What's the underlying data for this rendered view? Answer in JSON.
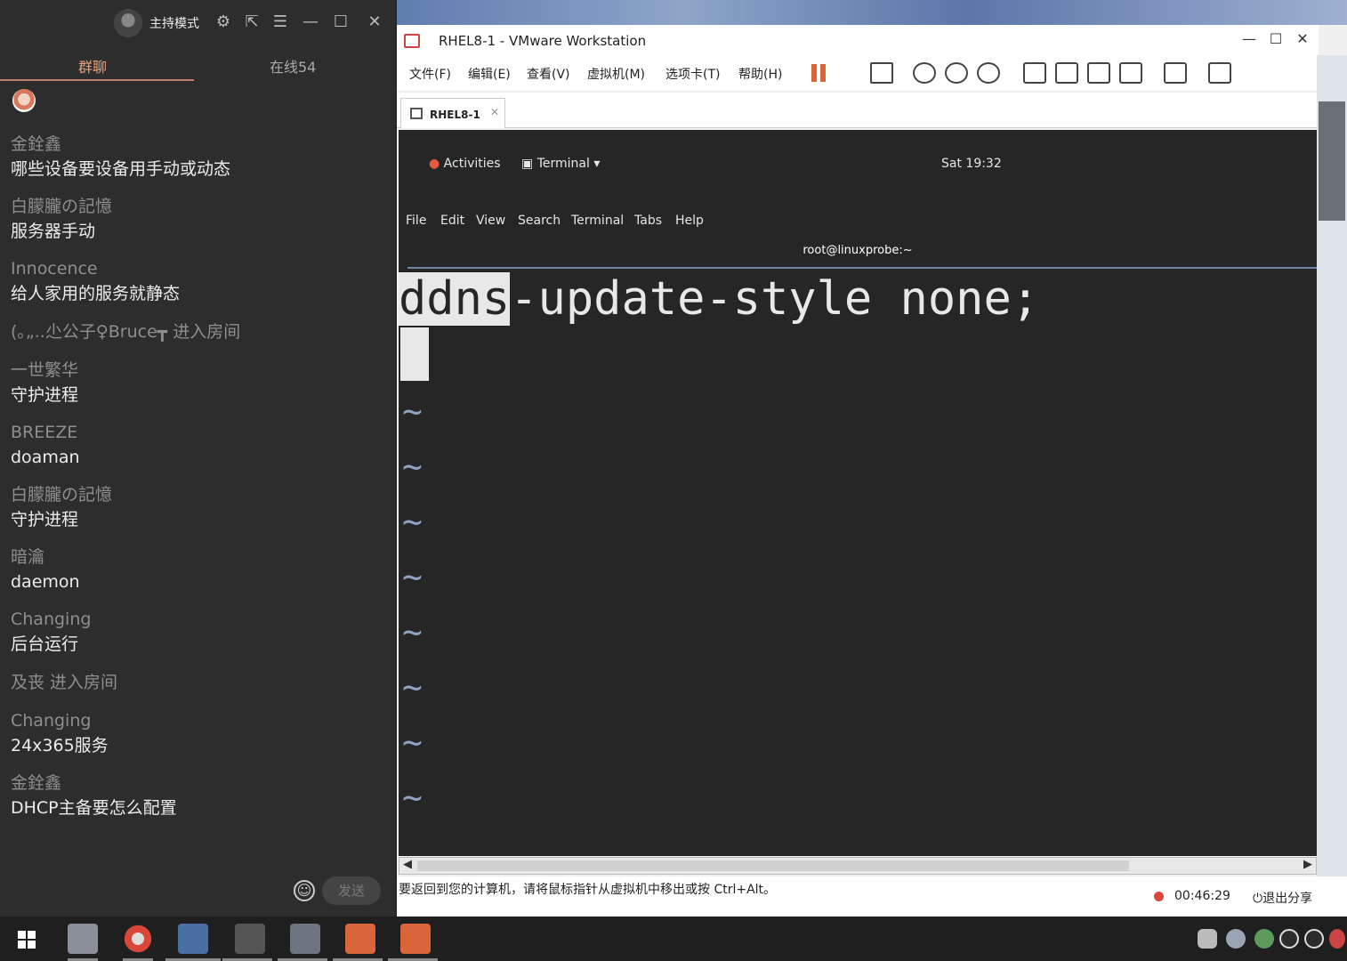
{
  "chat": {
    "host_mode": "主持模式",
    "tabs": {
      "group": "群聊",
      "online": "在线54"
    },
    "messages": [
      {
        "name": "金銓鑫",
        "text": "哪些设备要设备用手动或动态"
      },
      {
        "name": "白朦朧の記憶",
        "text": "服务器手动"
      },
      {
        "name": "Innocence",
        "text": "给人家用的服务就静态"
      },
      {
        "name": "(｡„..尐公子♀Bruce┳  进入房间",
        "text": ""
      },
      {
        "name": "一世繁华",
        "text": "守护进程"
      },
      {
        "name": "BREEZE",
        "text": "doaman"
      },
      {
        "name": "白朦朧の記憶",
        "text": "守护进程"
      },
      {
        "name": "暗瀹",
        "text": "daemon"
      },
      {
        "name": "Changing",
        "text": "后台运行"
      },
      {
        "name": "及丧 进入房间",
        "text": ""
      },
      {
        "name": "Changing",
        "text": "24x365服务"
      },
      {
        "name": "金銓鑫",
        "text": "DHCP主备要怎么配置"
      }
    ],
    "send_label": "发送"
  },
  "vmware": {
    "title": "RHEL8-1 - VMware Workstation",
    "menus": [
      "文件(F)",
      "编辑(E)",
      "查看(V)",
      "虚拟机(M)",
      "选项卡(T)",
      "帮助(H)"
    ],
    "tab_label": "RHEL8-1",
    "status_hint": "要返回到您的计算机，请将鼠标指针从虚拟机中移出或按 Ctrl+Alt。",
    "record_time": "00:46:29",
    "exit_share": "退出分享"
  },
  "guest": {
    "activities": "Activities",
    "app_menu": "Terminal",
    "clock": "Sat 19:32",
    "terminal_menus": [
      "File",
      "Edit",
      "View",
      "Search",
      "Terminal",
      "Tabs",
      "Help"
    ],
    "terminal_title": "root@linuxprobe:~",
    "vi_highlight": "ddns",
    "vi_rest": "-update-style none;",
    "tilde": "~"
  },
  "colors": {
    "chat_bg": "#2d2d2d",
    "tab_active": "#e8a07a",
    "terminal_bg": "#262627",
    "tilde": "#8fa2c0",
    "pause_orange": "#d9663b",
    "record_red": "#d9473a"
  }
}
